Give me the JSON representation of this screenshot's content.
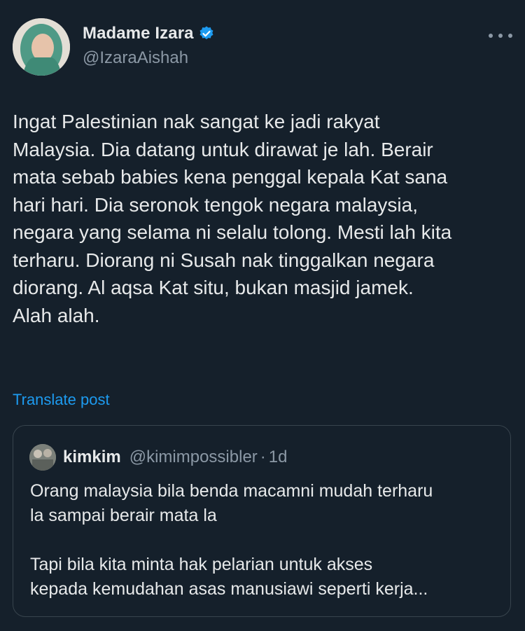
{
  "author": {
    "display_name": "Madame Izara",
    "handle": "@IzaraAishah",
    "verified": true
  },
  "post": {
    "text": "Ingat Palestinian nak sangat ke jadi rakyat\nMalaysia. Dia datang untuk dirawat je lah. Berair\nmata sebab babies kena penggal kepala Kat sana\nhari hari. Dia seronok tengok negara malaysia,\nnegara yang selama ni selalu tolong. Mesti lah kita\nterharu. Diorang ni Susah nak tinggalkan negara\ndiorang. Al aqsa Kat situ, bukan masjid jamek.\nAlah alah.",
    "translate_label": "Translate post"
  },
  "quote": {
    "display_name": "kimkim",
    "handle": "@kimimpossibler",
    "separator": "·",
    "time": "1d",
    "text": "Orang malaysia bila benda macamni mudah terharu\nla sampai berair mata la\n\nTapi bila kita minta hak pelarian untuk akses\nkepada kemudahan asas manusiawi seperti kerja..."
  },
  "icons": {
    "verified": "verified-badge-icon",
    "more": "more-options-icon"
  },
  "colors": {
    "background": "#15202b",
    "text": "#e7e9ea",
    "secondary": "#8b98a5",
    "accent": "#1d9bf0",
    "border": "#38444d"
  }
}
